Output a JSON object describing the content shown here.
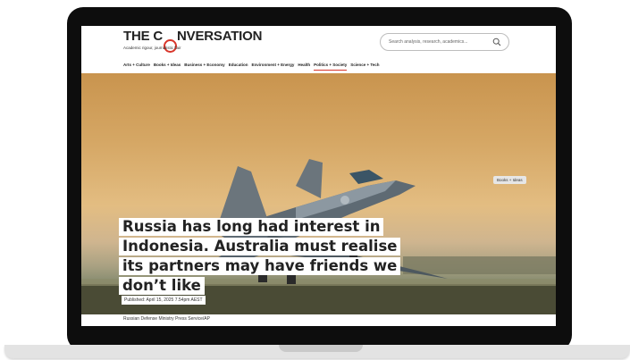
{
  "site": {
    "logo_text": "THE CONVERSATION",
    "logo_before": "THE C",
    "logo_after": "NVERSATION",
    "tagline": "Academic rigour, journalistic flair",
    "brand_color": "#d8352a"
  },
  "search": {
    "placeholder": "Search analysis, research, academics...",
    "icon": "search-icon"
  },
  "nav": {
    "items": [
      {
        "label": "Arts + Culture"
      },
      {
        "label": "Books + Ideas"
      },
      {
        "label": "Business + Economy"
      },
      {
        "label": "Education"
      },
      {
        "label": "Environment + Energy"
      },
      {
        "label": "Health"
      },
      {
        "label": "Politics + Society",
        "active": true
      },
      {
        "label": "Science + Tech"
      }
    ]
  },
  "article": {
    "category_tag": "Books + Ideas",
    "headline_lines": [
      "Russia has long had interest in",
      "Indonesia. Australia must realise",
      "its partners may have friends we",
      "don’t like"
    ],
    "published": "Published: April 15, 2025 7.54pm AEST",
    "image_caption": "Russian Defense Ministry Press Service/AP"
  }
}
